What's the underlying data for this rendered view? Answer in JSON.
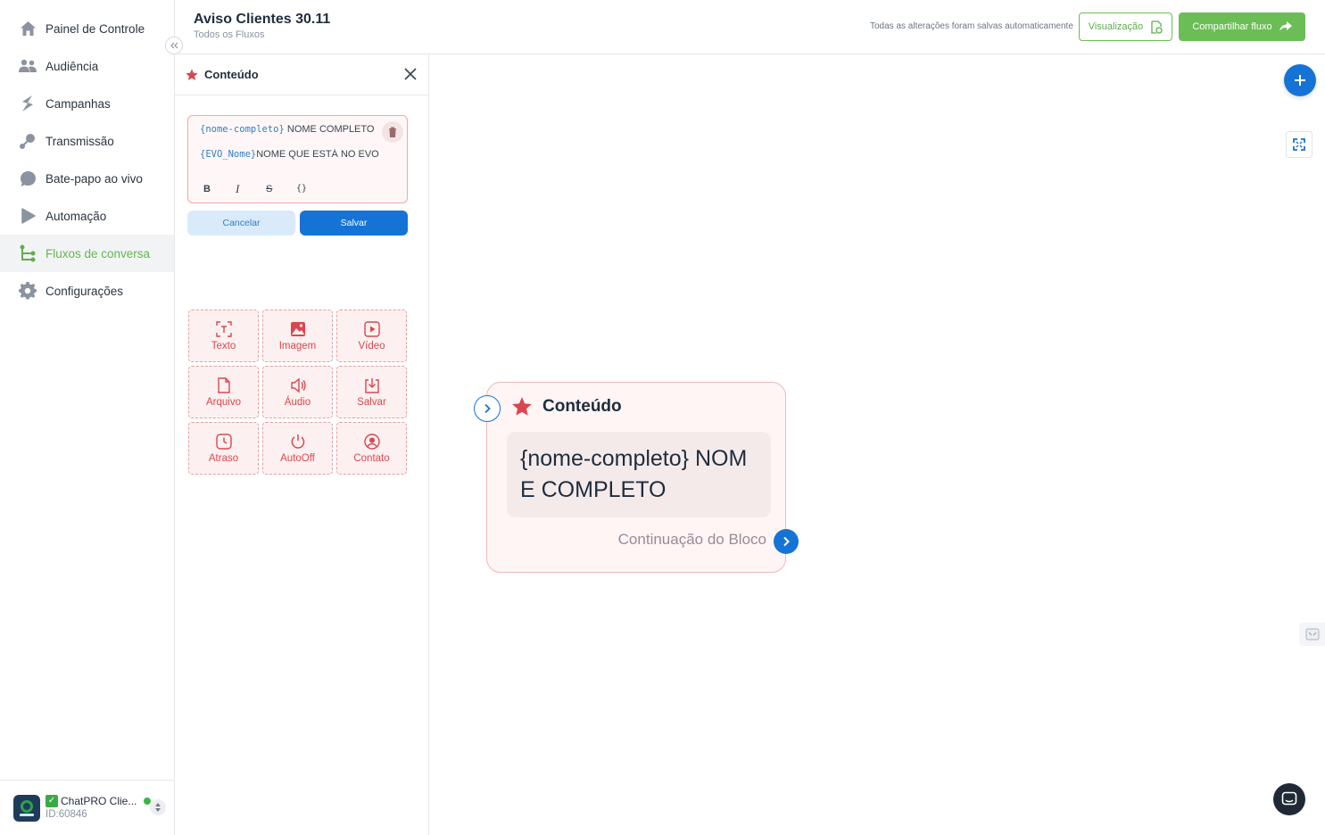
{
  "sidebar": {
    "items": [
      {
        "label": "Painel de Controle",
        "icon": "home-icon"
      },
      {
        "label": "Audiência",
        "icon": "users-icon"
      },
      {
        "label": "Campanhas",
        "icon": "campaign-icon"
      },
      {
        "label": "Transmissão",
        "icon": "broadcast-icon"
      },
      {
        "label": "Bate-papo ao vivo",
        "icon": "chat-bubble-icon"
      },
      {
        "label": "Automação",
        "icon": "play-icon"
      },
      {
        "label": "Fluxos de conversa",
        "icon": "flow-icon",
        "active": true
      },
      {
        "label": "Configurações",
        "icon": "gear-icon"
      }
    ],
    "account": {
      "name": "ChatPRO Clie...",
      "id": "ID:60846",
      "check": "✓",
      "status": "online"
    }
  },
  "header": {
    "title": "Aviso Clientes 30.11",
    "subtitle": "Todos os Fluxos",
    "autosave": "Todas as alterações foram salvas automaticamente",
    "preview_label": "Visualização",
    "share_label": "Compartilhar fluxo"
  },
  "panel": {
    "title": "Conteúdo",
    "editor": {
      "line1_var": "{nome-completo}",
      "line1_text": " NOME COMPLETO",
      "line2_var": "{EVO_Nome}",
      "line2_text": "NOME QUE ESTÁ NO EVO",
      "fmt_bold": "B",
      "fmt_italic": "I",
      "fmt_strike": "S",
      "fmt_code": "{}"
    },
    "cancel_label": "Cancelar",
    "save_label": "Salvar",
    "tiles": [
      {
        "label": "Texto",
        "icon": "text-icon"
      },
      {
        "label": "Imagem",
        "icon": "image-icon"
      },
      {
        "label": "Vídeo",
        "icon": "video-icon"
      },
      {
        "label": "Arquivo",
        "icon": "file-icon"
      },
      {
        "label": "Áudio",
        "icon": "audio-icon"
      },
      {
        "label": "Salvar",
        "icon": "download-icon"
      },
      {
        "label": "Atraso",
        "icon": "clock-icon"
      },
      {
        "label": "AutoOff",
        "icon": "power-icon"
      },
      {
        "label": "Contato",
        "icon": "contact-icon"
      }
    ]
  },
  "node": {
    "title": "Conteúdo",
    "body": "{nome-completo} NOME COMPLETO",
    "continuation": "Continuação do Bloco"
  },
  "colors": {
    "accent_green": "#6bbd55",
    "primary_blue": "#1673d6",
    "tile_red": "#d9474f"
  }
}
